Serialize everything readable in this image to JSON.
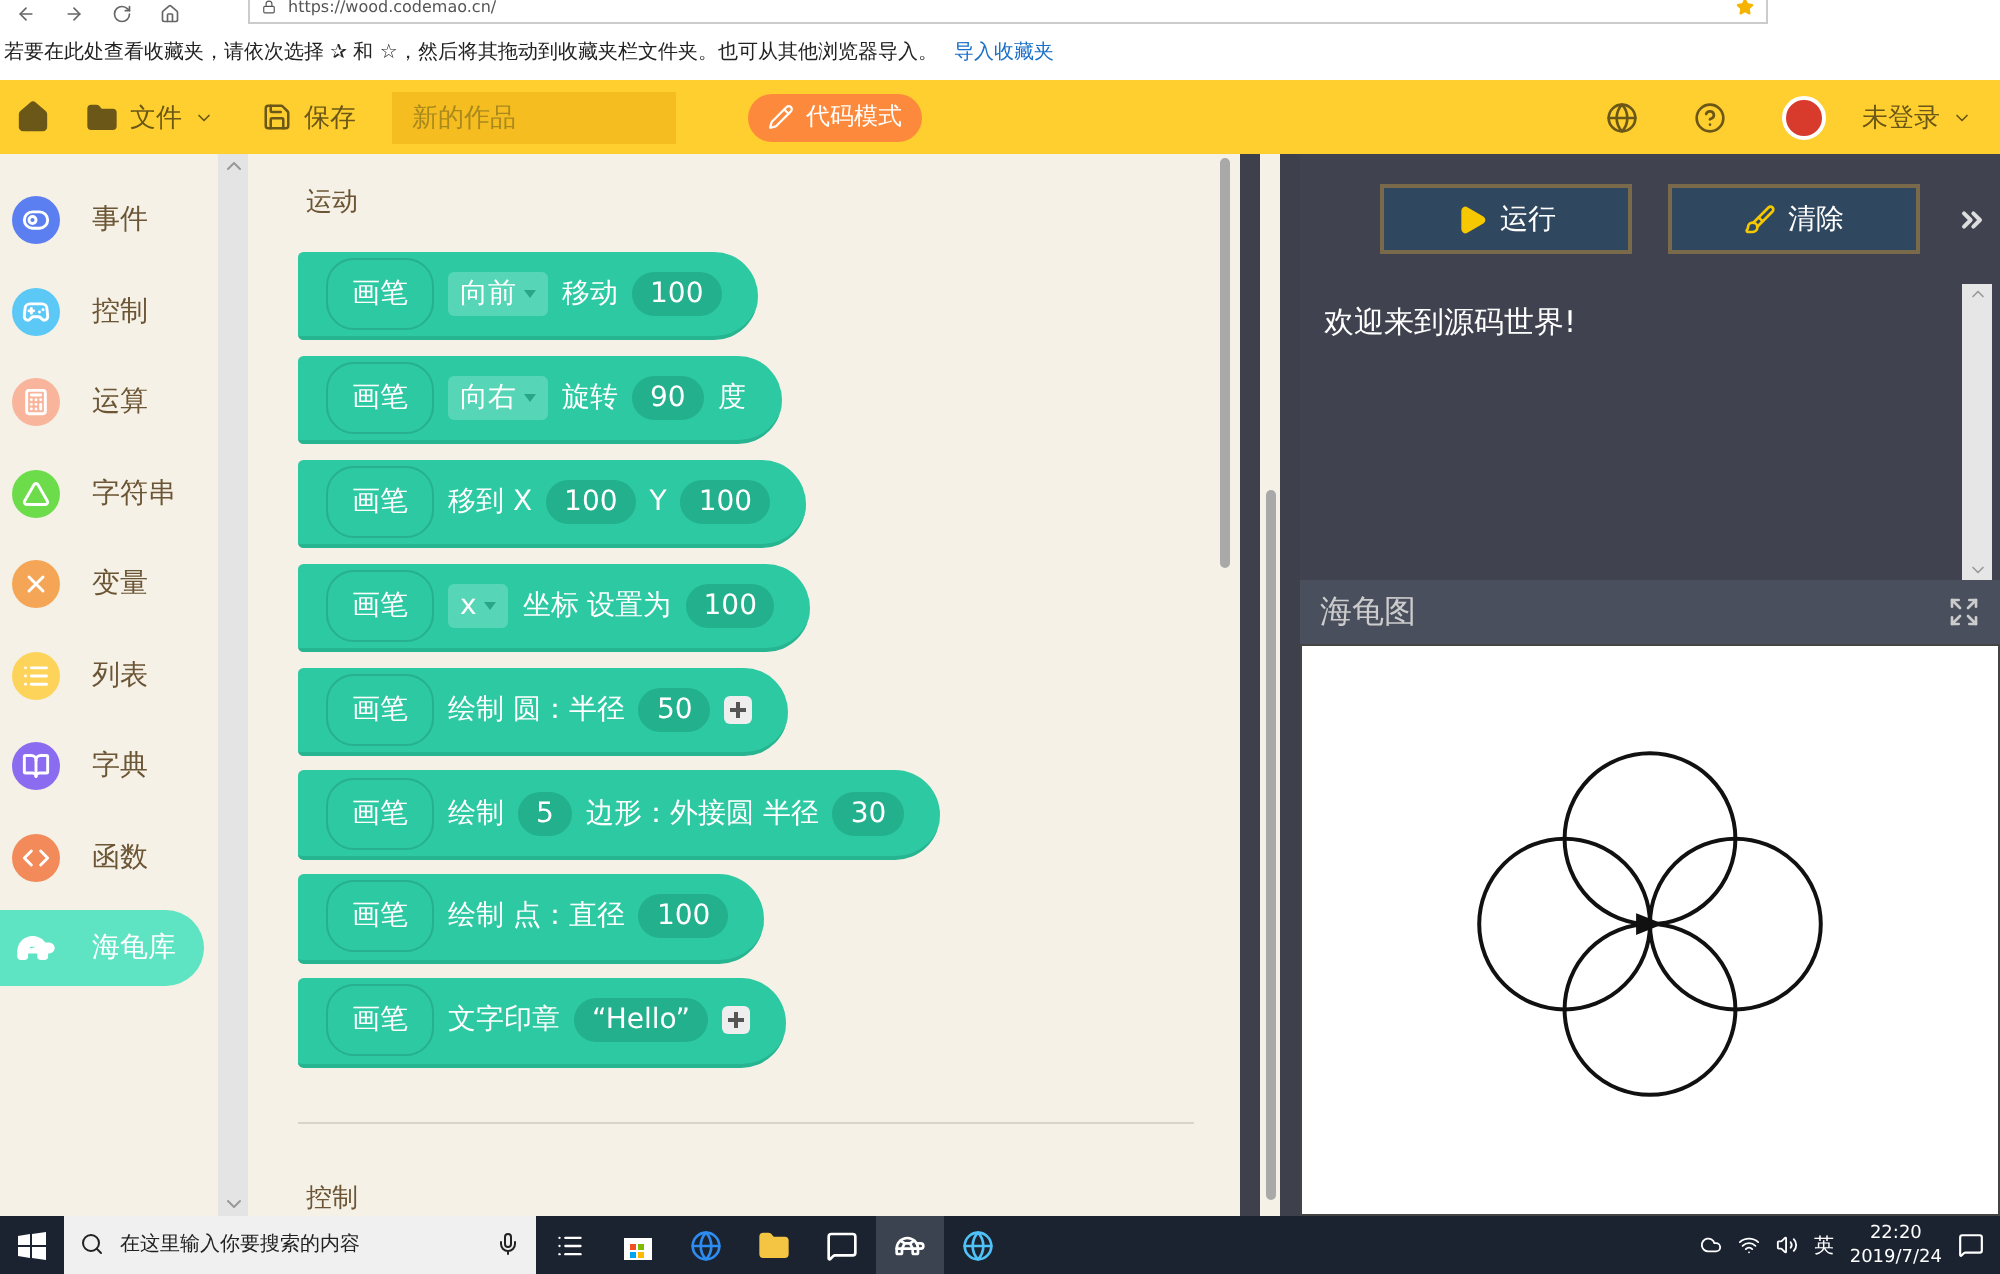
{
  "browser": {
    "url": "https://wood.codemao.cn/"
  },
  "favorites_bar": {
    "hint": "若要在此处查看收藏夹，请依次选择 ✰ 和 ☆，然后将其拖动到收藏夹栏文件夹。也可从其他浏览器导入。",
    "link": "导入收藏夹"
  },
  "app_bar": {
    "file_menu": "文件",
    "save": "保存",
    "title_field": {
      "placeholder": "新的作品"
    },
    "mode_button": "代码模式",
    "user": "未登录"
  },
  "sidebar": {
    "items": [
      {
        "label": "事件",
        "color": "#5b7ff0",
        "selected": false
      },
      {
        "label": "控制",
        "color": "#5cc8f5",
        "selected": false
      },
      {
        "label": "运算",
        "color": "#f9b49c",
        "selected": false
      },
      {
        "label": "字符串",
        "color": "#6ddc4a",
        "selected": false
      },
      {
        "label": "变量",
        "color": "#f4a656",
        "selected": false
      },
      {
        "label": "列表",
        "color": "#fdd35a",
        "selected": false
      },
      {
        "label": "字典",
        "color": "#8b6cf0",
        "selected": false
      },
      {
        "label": "函数",
        "color": "#f28a5a",
        "selected": false
      },
      {
        "label": "海龟库",
        "color": "#ffffff",
        "selected": true
      }
    ]
  },
  "blocks_panel": {
    "section_title": "运动",
    "blocks": [
      {
        "parts": [
          {
            "kind": "pen",
            "text": "画笔"
          },
          {
            "kind": "dropdown",
            "text": "向前"
          },
          {
            "kind": "text",
            "text": "移动"
          },
          {
            "kind": "value",
            "text": "100"
          }
        ]
      },
      {
        "parts": [
          {
            "kind": "pen",
            "text": "画笔"
          },
          {
            "kind": "dropdown",
            "text": "向右"
          },
          {
            "kind": "text",
            "text": "旋转"
          },
          {
            "kind": "value",
            "text": "90"
          },
          {
            "kind": "text",
            "text": "度"
          }
        ]
      },
      {
        "parts": [
          {
            "kind": "pen",
            "text": "画笔"
          },
          {
            "kind": "text",
            "text": "移到 X"
          },
          {
            "kind": "value",
            "text": "100"
          },
          {
            "kind": "text",
            "text": "Y"
          },
          {
            "kind": "value",
            "text": "100"
          }
        ]
      },
      {
        "parts": [
          {
            "kind": "pen",
            "text": "画笔"
          },
          {
            "kind": "dropdown",
            "text": "x"
          },
          {
            "kind": "text",
            "text": "坐标 设置为"
          },
          {
            "kind": "value",
            "text": "100"
          }
        ]
      },
      {
        "parts": [
          {
            "kind": "pen",
            "text": "画笔"
          },
          {
            "kind": "text",
            "text": "绘制 圆：半径"
          },
          {
            "kind": "value",
            "text": "50"
          },
          {
            "kind": "plus"
          }
        ]
      },
      {
        "parts": [
          {
            "kind": "pen",
            "text": "画笔"
          },
          {
            "kind": "text",
            "text": "绘制"
          },
          {
            "kind": "value",
            "text": "5"
          },
          {
            "kind": "text",
            "text": "边形：外接圆 半径"
          },
          {
            "kind": "value",
            "text": "30"
          }
        ]
      },
      {
        "parts": [
          {
            "kind": "pen",
            "text": "画笔"
          },
          {
            "kind": "text",
            "text": "绘制 点：直径"
          },
          {
            "kind": "value",
            "text": "100"
          }
        ]
      },
      {
        "parts": [
          {
            "kind": "pen",
            "text": "画笔"
          },
          {
            "kind": "text",
            "text": "文字印章"
          },
          {
            "kind": "value",
            "text": "“Hello”"
          },
          {
            "kind": "plus"
          }
        ]
      }
    ],
    "next_section_title": "控制"
  },
  "console": {
    "run_button": "运行",
    "clear_button": "清除",
    "output": "欢迎来到源码世界!"
  },
  "turtle_panel": {
    "title": "海龟图"
  },
  "taskbar": {
    "search": {
      "placeholder": "在这里输入你要搜索的内容"
    },
    "ime": "英",
    "time": "22:20",
    "date": "2019/7/24"
  }
}
